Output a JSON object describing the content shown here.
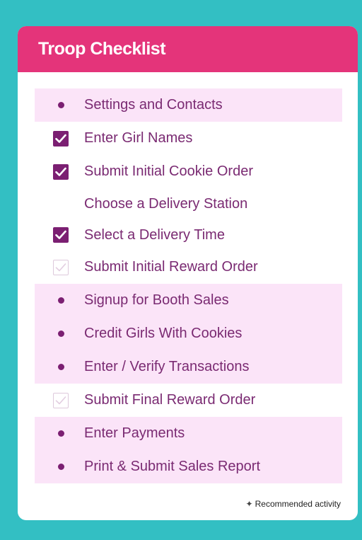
{
  "header": {
    "title": "Troop Checklist"
  },
  "groups": [
    {
      "shaded": true,
      "items": [
        {
          "label": "Settings and Contacts",
          "marker": "bullet"
        }
      ]
    },
    {
      "shaded": false,
      "items": [
        {
          "label": "Enter Girl Names",
          "marker": "checked"
        },
        {
          "label": "Submit Initial Cookie Order",
          "marker": "checked"
        },
        {
          "label": "Choose a Delivery Station",
          "marker": "none"
        },
        {
          "label": "Select a Delivery Time",
          "marker": "checked"
        },
        {
          "label": "Submit Initial Reward Order",
          "marker": "unchecked"
        }
      ]
    },
    {
      "shaded": true,
      "items": [
        {
          "label": "Signup for Booth Sales",
          "marker": "bullet"
        },
        {
          "label": "Credit Girls With Cookies",
          "marker": "bullet"
        },
        {
          "label": "Enter / Verify Transactions",
          "marker": "bullet"
        }
      ]
    },
    {
      "shaded": false,
      "items": [
        {
          "label": "Submit Final Reward Order",
          "marker": "unchecked"
        }
      ]
    },
    {
      "shaded": true,
      "items": [
        {
          "label": "Enter Payments",
          "marker": "bullet"
        },
        {
          "label": "Print & Submit Sales Report",
          "marker": "bullet"
        }
      ]
    }
  ],
  "footnote": {
    "symbol": "✦",
    "text": "Recommended activity"
  },
  "colors": {
    "page_bg": "#33bfc3",
    "header_bg": "#e4347a",
    "accent": "#7b1f72",
    "shade": "#fbe4f8"
  }
}
